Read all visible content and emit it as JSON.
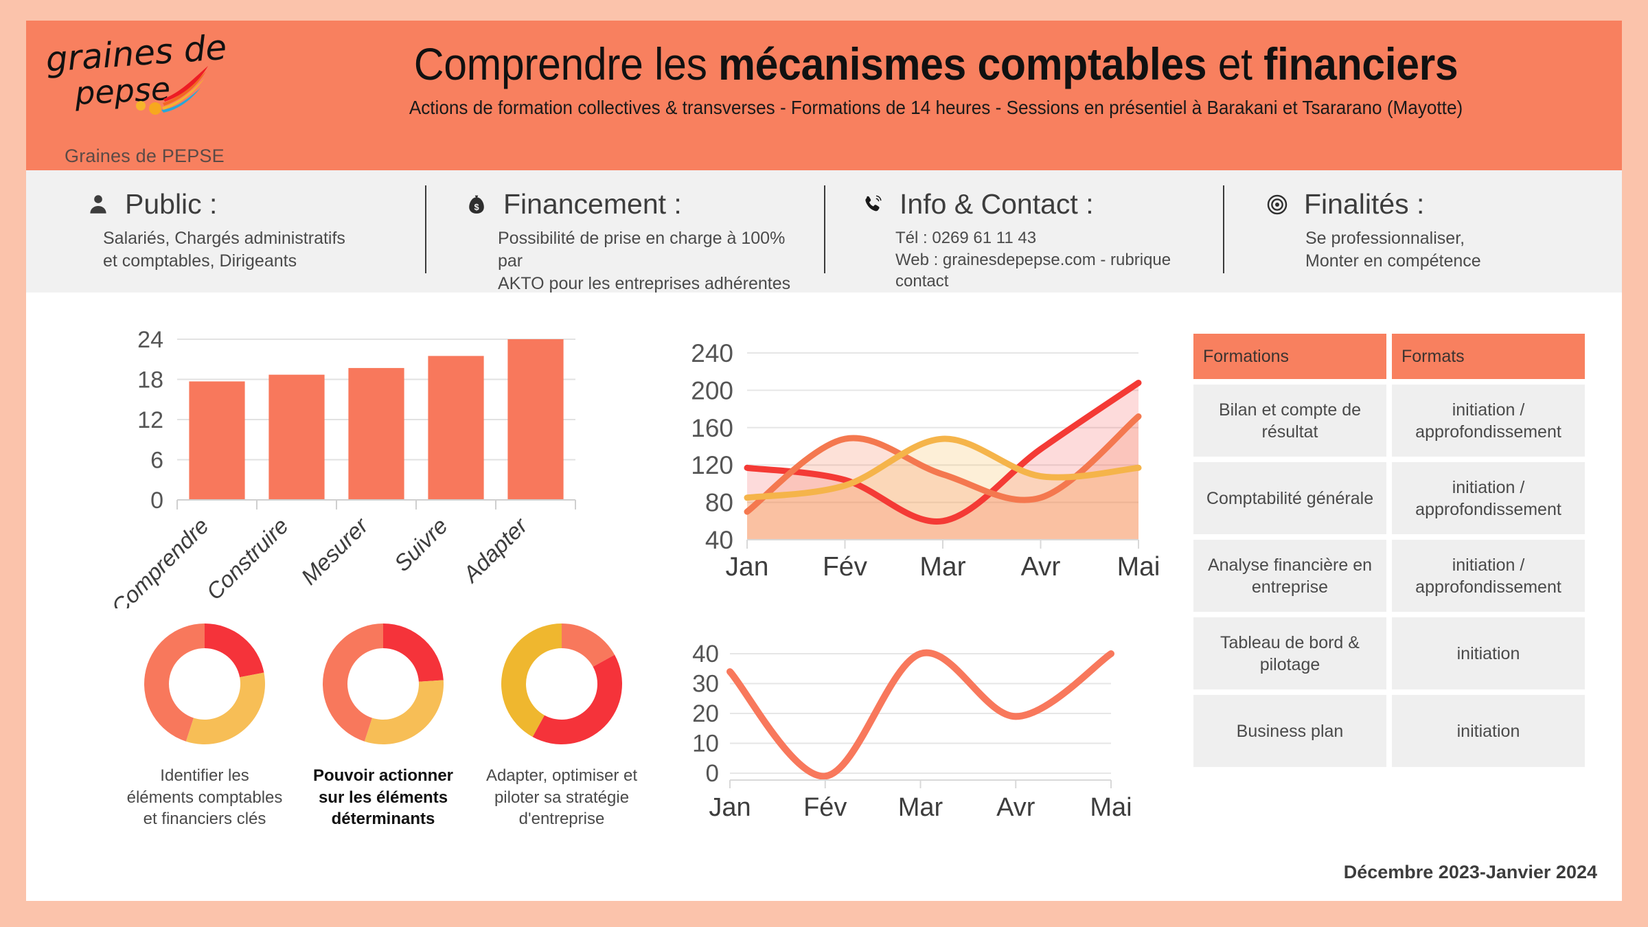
{
  "brand": {
    "logo_text_line1": "graines de",
    "logo_text_line2": "pepse",
    "name": "Graines de PEPSE"
  },
  "header": {
    "title_part1": "Comprendre ",
    "title_part2": "les ",
    "title_bold1": "mécanismes comptables ",
    "title_part3": "et ",
    "title_bold2": "financiers",
    "subtitle": "Actions de formation collectives & transverses - Formations de 14 heures -  Sessions en présentiel à Barakani et Tsararano (Mayotte)",
    "bg_color": "#f8805f",
    "border_color": "#fbc3ab"
  },
  "infobar": [
    {
      "icon": "person-icon",
      "title": "Public :",
      "body_line1": "Salariés, Chargés administratifs",
      "body_line2": "et comptables, Dirigeants"
    },
    {
      "icon": "money-bag-icon",
      "title": "Financement :",
      "body_line1": "Possibilité de prise en charge à 100% par",
      "body_line2": "AKTO pour les entreprises adhérentes"
    },
    {
      "icon": "phone-icon",
      "title": "Info & Contact :",
      "body_line1": "Tél : 0269 61 11 43",
      "body_line2": "Web : grainesdepepse.com - rubrique contact"
    },
    {
      "icon": "target-icon",
      "title": "Finalités :",
      "body_line1": "Se professionnaliser,",
      "body_line2": "Monter en compétence"
    }
  ],
  "chart_data": [
    {
      "type": "bar",
      "name": "competency-steps-bar-chart",
      "categories": [
        "Comprendre",
        "Construire",
        "Mesurer",
        "Suivre",
        "Adapter"
      ],
      "values": [
        17.7,
        18.7,
        19.7,
        21.5,
        24
      ],
      "title": "",
      "xlabel": "",
      "ylabel": "",
      "ylim": [
        0,
        24
      ],
      "yticks": [
        0,
        6,
        12,
        18,
        24
      ],
      "grid": true,
      "bar_color": "#f8785c",
      "xtick_rotation": -45
    },
    {
      "type": "area",
      "name": "monthly-area-chart",
      "x": [
        "Jan",
        "Fév",
        "Mar",
        "Avr",
        "Mai"
      ],
      "series": [
        {
          "name": "serie-rouge",
          "values": [
            117,
            104,
            60,
            137,
            208
          ],
          "color": "#f43a35",
          "fill": "rgba(244,58,53,0.18)"
        },
        {
          "name": "serie-saumon",
          "values": [
            70,
            148,
            110,
            85,
            172
          ],
          "color": "#f4784f",
          "fill": "rgba(244,120,79,0.22)"
        },
        {
          "name": "serie-jaune",
          "values": [
            85,
            98,
            148,
            108,
            117
          ],
          "color": "#f5b44a",
          "fill": "rgba(245,180,74,0.22)"
        }
      ],
      "ylim": [
        40,
        240
      ],
      "yticks": [
        40,
        80,
        120,
        160,
        200,
        240
      ],
      "grid": true,
      "legend": "none"
    },
    {
      "type": "line",
      "name": "monthly-line-chart",
      "x": [
        "Jan",
        "Fév",
        "Mar",
        "Avr",
        "Mai"
      ],
      "values": [
        34,
        -1,
        40,
        19,
        40
      ],
      "ylim": [
        0,
        40
      ],
      "yticks": [
        0,
        10,
        20,
        30,
        40
      ],
      "grid": true,
      "line_color": "#f8785c"
    },
    {
      "type": "pie",
      "name": "donut-identifier",
      "values": [
        22,
        33,
        45
      ],
      "colors": [
        "#f5333a",
        "#f7be56",
        "#f8785c"
      ],
      "label": "Identifier les\néléments  comptables\net financiers clés",
      "label_line1": "Identifier les",
      "label_line2": "éléments  comptables",
      "label_line3": "et financiers clés"
    },
    {
      "type": "pie",
      "name": "donut-actionner",
      "values": [
        24,
        31,
        45
      ],
      "colors": [
        "#f5333a",
        "#f7be56",
        "#f8785c"
      ],
      "label_line1": "Pouvoir actionner",
      "label_line2": "sur les éléments",
      "label_line3": "déterminants"
    },
    {
      "type": "pie",
      "name": "donut-adapter",
      "values": [
        17,
        41,
        42
      ],
      "colors": [
        "#f8785c",
        "#f5333a",
        "#efb72f"
      ],
      "label_line1": "Adapter, optimiser et",
      "label_line2": "piloter  sa stratégie",
      "label_line3": "d'entreprise"
    }
  ],
  "table": {
    "headers": [
      "Formations",
      "Formats"
    ],
    "rows": [
      [
        "Bilan et compte de résultat",
        "initiation / approfondissement"
      ],
      [
        "Comptabilité générale",
        "initiation / approfondissement"
      ],
      [
        "Analyse financière en entreprise",
        "initiation / approfondissement"
      ],
      [
        "Tableau de bord & pilotage",
        "initiation"
      ],
      [
        "Business plan",
        "initiation"
      ]
    ],
    "header_bg": "#f8805f",
    "cell_bg": "#efefef"
  },
  "footer": {
    "date": "Décembre 2023-Janvier 2024"
  }
}
